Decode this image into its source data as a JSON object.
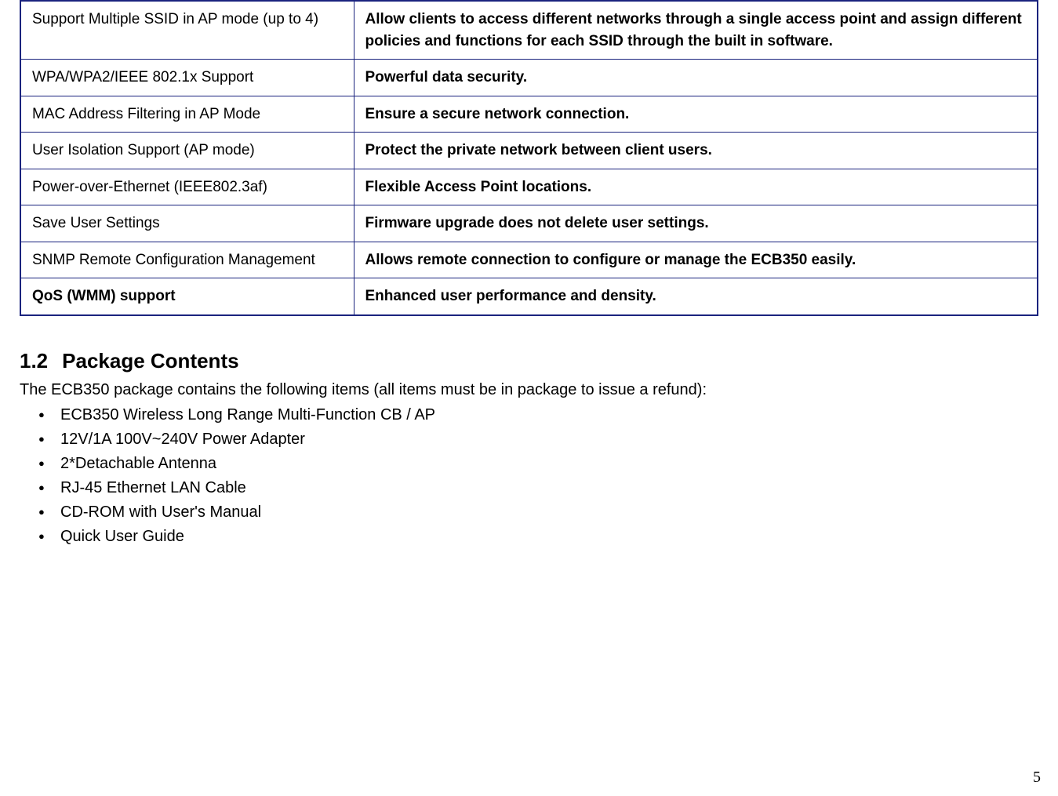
{
  "features_table": {
    "rows": [
      {
        "name": "Support Multiple SSID in AP mode (up to 4)",
        "benefit": "Allow clients to access different networks through a single access point and assign different policies and functions for each SSID through the built in software.",
        "bold_name": false
      },
      {
        "name": "WPA/WPA2/IEEE 802.1x Support",
        "benefit": "Powerful data security.",
        "bold_name": false
      },
      {
        "name": "MAC Address Filtering in AP Mode",
        "benefit": "Ensure a secure network connection.",
        "bold_name": false
      },
      {
        "name": "User Isolation Support (AP mode)",
        "benefit": "Protect the private network between client users.",
        "bold_name": false
      },
      {
        "name": "Power-over-Ethernet (IEEE802.3af)",
        "benefit": "Flexible Access Point locations.",
        "bold_name": false
      },
      {
        "name": "Save User Settings",
        "benefit": "Firmware upgrade does not delete user settings.",
        "bold_name": false
      },
      {
        "name": "SNMP Remote Configuration Management",
        "benefit": "Allows remote connection to configure or manage the ECB350 easily.",
        "bold_name": false
      },
      {
        "name": "QoS (WMM) support",
        "benefit": "Enhanced user performance and density.",
        "bold_name": true
      }
    ]
  },
  "section": {
    "number": "1.2",
    "title": "Package Contents",
    "intro": "The ECB350 package contains the following items (all items must be in package to issue a refund):",
    "items": [
      "ECB350 Wireless Long Range Multi-Function CB / AP",
      "12V/1A 100V~240V Power Adapter",
      "2*Detachable Antenna",
      "RJ-45 Ethernet LAN Cable",
      "CD-ROM with User's Manual",
      "Quick User Guide"
    ]
  },
  "page_number": "5"
}
